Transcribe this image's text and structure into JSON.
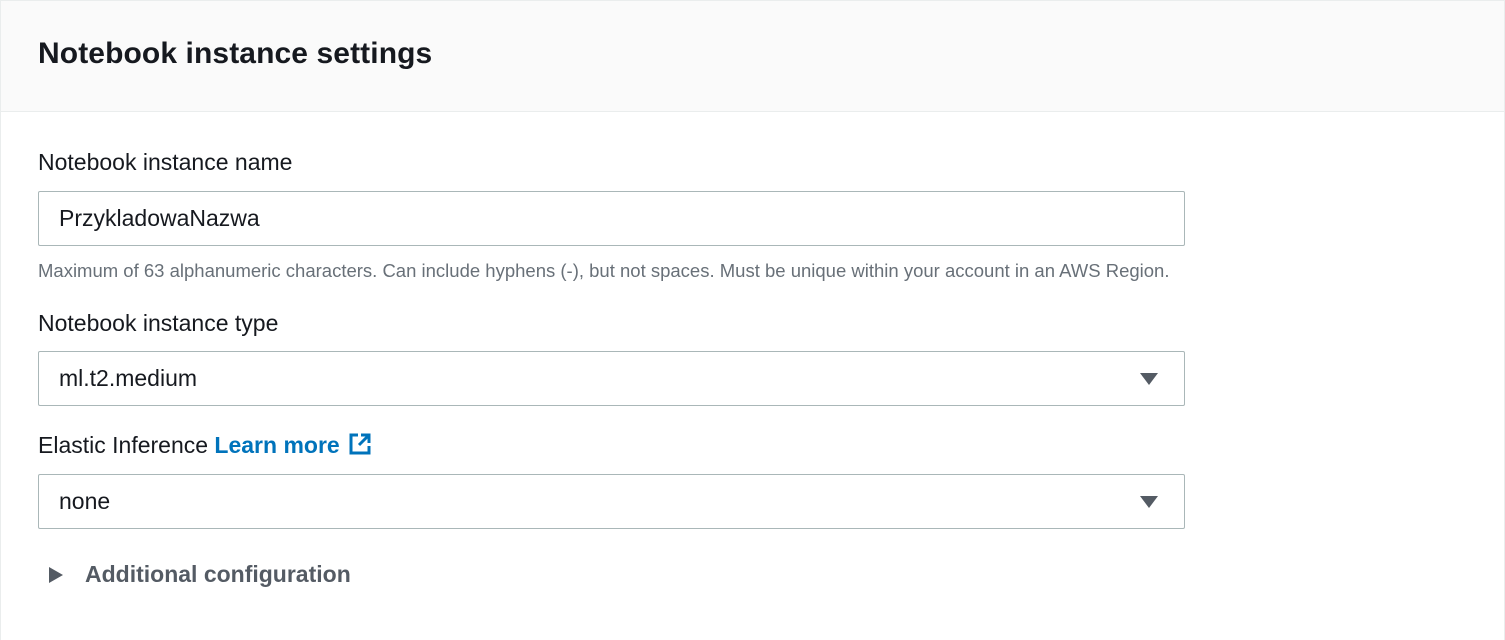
{
  "panel": {
    "title": "Notebook instance settings"
  },
  "name_field": {
    "label": "Notebook instance name",
    "value": "PrzykladowaNazwa",
    "hint": "Maximum of 63 alphanumeric characters. Can include hyphens (-), but not spaces. Must be unique within your account in an AWS Region."
  },
  "type_field": {
    "label": "Notebook instance type",
    "selected": "ml.t2.medium"
  },
  "inference_field": {
    "label": "Elastic Inference",
    "learn_more": "Learn more",
    "selected": "none"
  },
  "additional": {
    "label": "Additional configuration"
  },
  "colors": {
    "link": "#0073bb",
    "text": "#16191f",
    "hint": "#687078",
    "border": "#aab7b8",
    "header_bg": "#fafafa"
  },
  "icons": {
    "select_caret": "caret-down-icon",
    "external_link": "external-link-icon",
    "expander": "caret-right-icon"
  }
}
